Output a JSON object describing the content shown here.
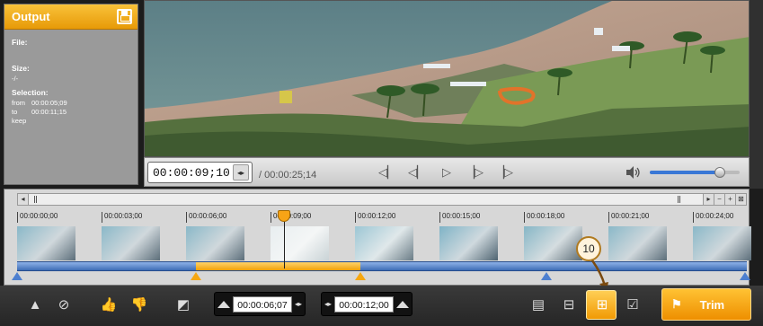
{
  "output_panel": {
    "title": "Output",
    "file_label": "File:",
    "size_label": "Size:",
    "size_value": "-/-",
    "selection_label": "Selection:",
    "from_label": "from",
    "from_value": "00:00:05;09",
    "to_label": "to",
    "to_value": "00:00:11;15",
    "mode": "keep"
  },
  "player": {
    "current_time": "00:00:09;10",
    "total_duration": "/ 00:00:25;14",
    "volume_level": 0.78
  },
  "timeline": {
    "ticks": [
      "00:00:00;00",
      "00:00:03;00",
      "00:00:06;00",
      "00:00:09;00",
      "00:00:12;00",
      "00:00:15;00",
      "00:00:18;00",
      "00:00:21;00",
      "00:00:24;00"
    ],
    "selection_start_fraction": 0.245,
    "selection_end_fraction": 0.47,
    "playhead_fraction": 0.36
  },
  "toolbar": {
    "start_time": "00:00:06;07",
    "end_time": "00:00:12;00",
    "trim_label": "Trim",
    "callout_number": "10"
  },
  "colors": {
    "accent_orange": "#f1a008",
    "timeline_blue": "#3e6db6"
  }
}
